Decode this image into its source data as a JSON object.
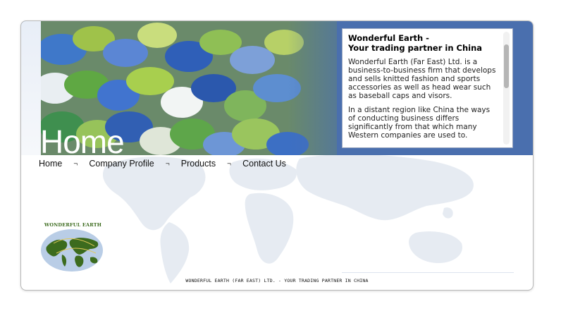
{
  "header": {
    "page_title": "Home"
  },
  "intro": {
    "title_line1": "Wonderful Earth -",
    "title_line2": "Your trading partner in China",
    "paragraph1": "Wonderful Earth (Far East) Ltd. is a business-to-business firm that develops and sells knitted fashion and sports accessories as well as head wear such as baseball caps and visors.",
    "paragraph2": "In a distant region like China the ways of conducting business differs significantly from that which many Western companies are used to."
  },
  "nav": {
    "items": [
      {
        "label": "Home"
      },
      {
        "label": "Company Profile"
      },
      {
        "label": "Products"
      },
      {
        "label": "Contact Us"
      }
    ],
    "separator": "¬"
  },
  "logo": {
    "text": "WONDERFUL EARTH"
  },
  "footer": {
    "text": "WONDERFUL EARTH (FAR EAST) LTD. - YOUR TRADING PARTNER IN CHINA"
  },
  "colors": {
    "header_blue": "#4a6fae",
    "logo_green": "#3c6b1e",
    "logo_ocean": "#b9cde6"
  }
}
